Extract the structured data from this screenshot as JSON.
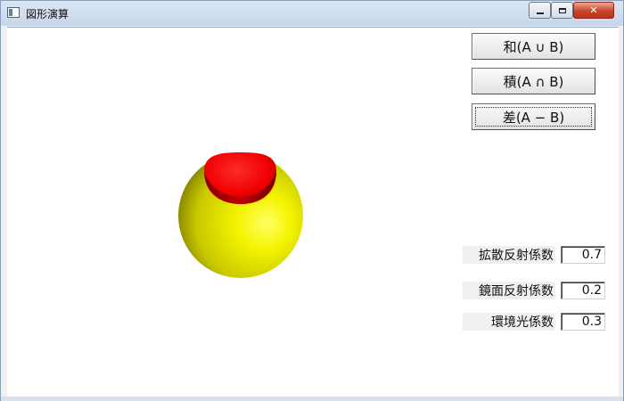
{
  "window": {
    "title": "図形演算",
    "controls": {
      "minimize": "minimize-icon",
      "maximize": "maximize-icon",
      "close": "close-icon"
    }
  },
  "operations": {
    "union_label": "和(A ∪ B)",
    "intersection_label": "積(A ∩ B)",
    "difference_label": "差(A − B)",
    "active": "difference"
  },
  "coefficients": {
    "diffuse": {
      "label": "拡散反射係数",
      "value": "0.7"
    },
    "specular": {
      "label": "鏡面反射係数",
      "value": "0.2"
    },
    "ambient": {
      "label": "環境光係数",
      "value": "0.3"
    }
  },
  "scene": {
    "description_colors": {
      "sphere_a": "#f2f200",
      "cavity": "#ff1a1a",
      "background": "#ffffff"
    }
  }
}
